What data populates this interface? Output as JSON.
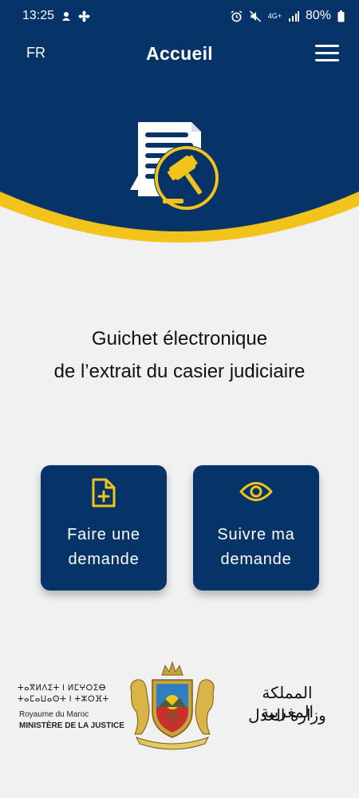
{
  "status_bar": {
    "time": "13:25",
    "battery": "80%",
    "network": "4G+"
  },
  "app_bar": {
    "language": "FR",
    "title": "Accueil"
  },
  "headline": {
    "line1": "Guichet électronique",
    "line2": "de l’extrait du casier judiciaire"
  },
  "actions": [
    {
      "line1": "Faire une",
      "line2": "demande",
      "icon": "file-plus-icon"
    },
    {
      "line1": "Suivre ma",
      "line2": "demande",
      "icon": "eye-icon"
    }
  ],
  "footer": {
    "tifinagh_line1": "ⵜⴰⴳⵍⴷⵉⵜ ⵏ ⵍⵎⵖⵔⵉⴱ",
    "tifinagh_line2": "ⵜⴰⵎⴰⵡⴰⵙⵜ ⵏ ⵜⵣⵔⴼⵜ",
    "french_line1": "Royaume du Maroc",
    "french_line2": "MINISTÈRE DE LA JUSTICE",
    "arabic_line1": "المملكة المغربية",
    "arabic_line2": "وزارة العدل"
  },
  "colors": {
    "primary": "#073468",
    "accent": "#f2c31b",
    "background": "#f1f1f2"
  }
}
